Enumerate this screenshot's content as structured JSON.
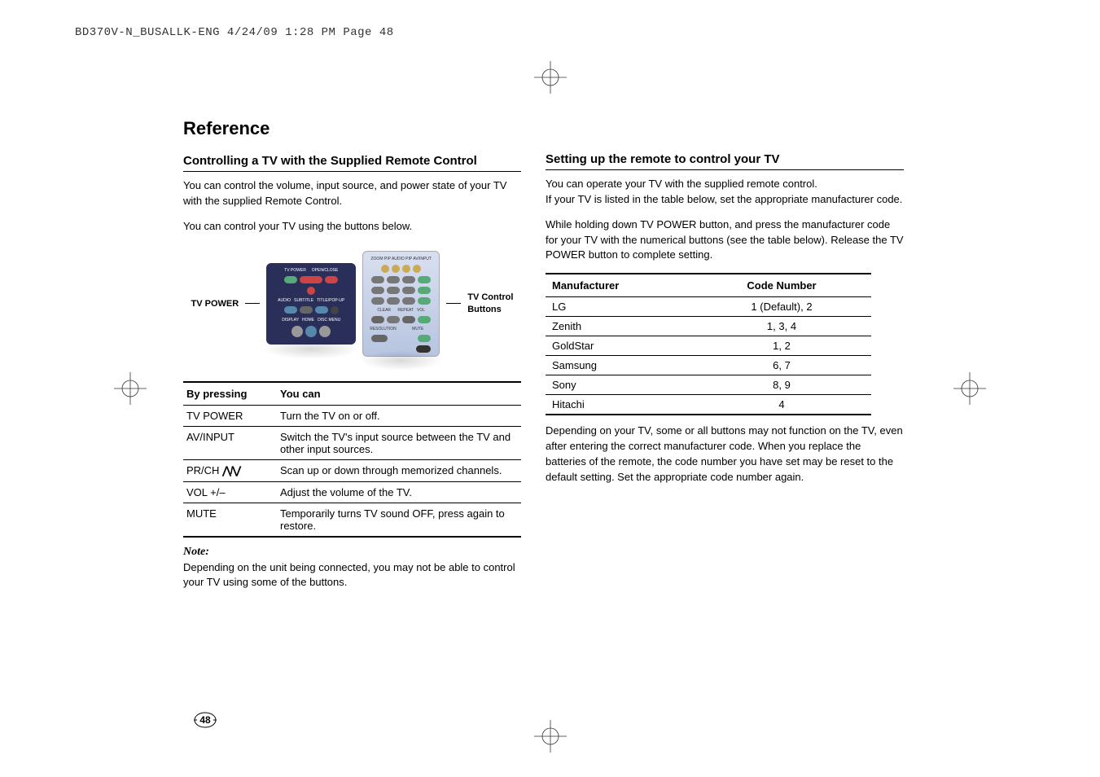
{
  "print_header": "BD370V-N_BUSALLK-ENG  4/24/09  1:28 PM  Page 48",
  "page_number": "48",
  "left": {
    "title": "Reference",
    "section_heading": "Controlling a TV with the Supplied Remote Control",
    "intro1": "You can control the volume, input source, and power state of your TV with the supplied Remote Control.",
    "intro2": "You can control your TV using the buttons below.",
    "figure": {
      "label_left": "TV POWER",
      "label_right_l1": "TV Control",
      "label_right_l2": "Buttons"
    },
    "func_table": {
      "header1": "By pressing",
      "header2": "You can",
      "rows": [
        {
          "press": "TV POWER",
          "action": "Turn the TV on or off."
        },
        {
          "press": "AV/INPUT",
          "action": "Switch the TV's input source between the TV and other input sources."
        },
        {
          "press": "PR/CH ",
          "press_suffix": "U/u",
          "action": "Scan up or down through memorized channels."
        },
        {
          "press": "VOL +/–",
          "action": "Adjust the volume of the TV."
        },
        {
          "press": "MUTE",
          "action": "Temporarily turns TV sound OFF, press again to restore."
        }
      ]
    },
    "note_heading": "Note:",
    "note_body": "Depending on the unit being connected, you may not be able to control your TV using some of the buttons."
  },
  "right": {
    "section_heading": "Setting up the remote to control your TV",
    "p1": "You can operate your TV with the supplied remote control.",
    "p2": "If your TV is listed in the table below, set the appropriate manufacturer code.",
    "p3": "While holding down TV POWER button, and press the manufacturer code for your TV with the numerical buttons (see the table below). Release the TV POWER button to complete setting.",
    "code_table": {
      "header1": "Manufacturer",
      "header2": "Code Number",
      "rows": [
        {
          "m": "LG",
          "c": "1 (Default), 2"
        },
        {
          "m": "Zenith",
          "c": "1, 3, 4"
        },
        {
          "m": "GoldStar",
          "c": "1, 2"
        },
        {
          "m": "Samsung",
          "c": "6, 7"
        },
        {
          "m": "Sony",
          "c": "8, 9"
        },
        {
          "m": "Hitachi",
          "c": "4"
        }
      ]
    },
    "p4": "Depending on your TV, some or all buttons may not function on the TV, even after entering the correct manufacturer code. When you replace the batteries of the remote, the code number you have set may be reset to the default setting. Set the appropriate code number again."
  }
}
